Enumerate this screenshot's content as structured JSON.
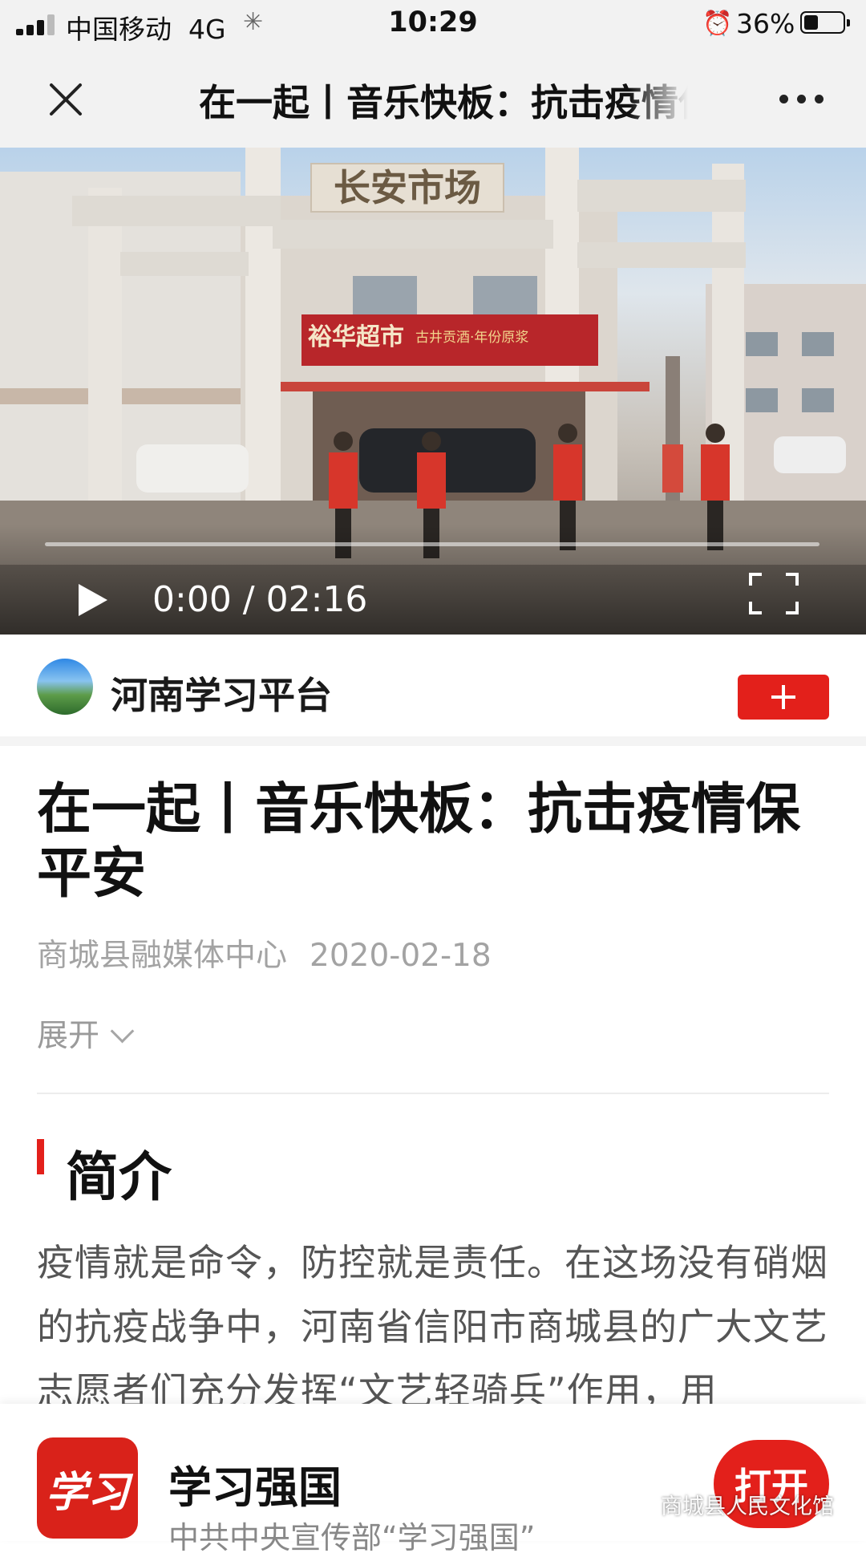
{
  "status_bar": {
    "carrier": "中国移动",
    "network": "4G",
    "time": "10:29",
    "battery_percent": "36%",
    "battery_level": 0.36
  },
  "nav": {
    "title": "在一起丨音乐快板：抗击疫情保平安"
  },
  "video": {
    "time_display": "0:00 / 02:16",
    "progress": 0,
    "sign_main": "长安市场",
    "store_sign": "裕华超市",
    "store_sign_sub": "古井贡酒·年份原浆"
  },
  "publisher": {
    "name": "河南学习平台",
    "follow_symbol": "+"
  },
  "article": {
    "title": "在一起丨音乐快板：抗击疫情保平安",
    "source": "商城县融媒体中心",
    "date": "2020-02-18",
    "expand_label": "展开"
  },
  "section": {
    "heading": "简介",
    "summary": "疫情就是命令，防控就是责任。在这场没有硝烟的抗疫战争中，河南省信阳市商城县的广大文艺志愿者们充分发挥“文艺轻骑兵”作用，用"
  },
  "app_banner": {
    "logo_text": "学习",
    "name": "学习强国",
    "description": "中共中央宣传部“学习强国”",
    "open_label": "打开"
  },
  "watermark": {
    "text": "商城县人民文化馆"
  },
  "colors": {
    "accent_red": "#e3201b",
    "bar_gray": "#f2f2f2",
    "meta_gray": "#a3a3a3"
  }
}
